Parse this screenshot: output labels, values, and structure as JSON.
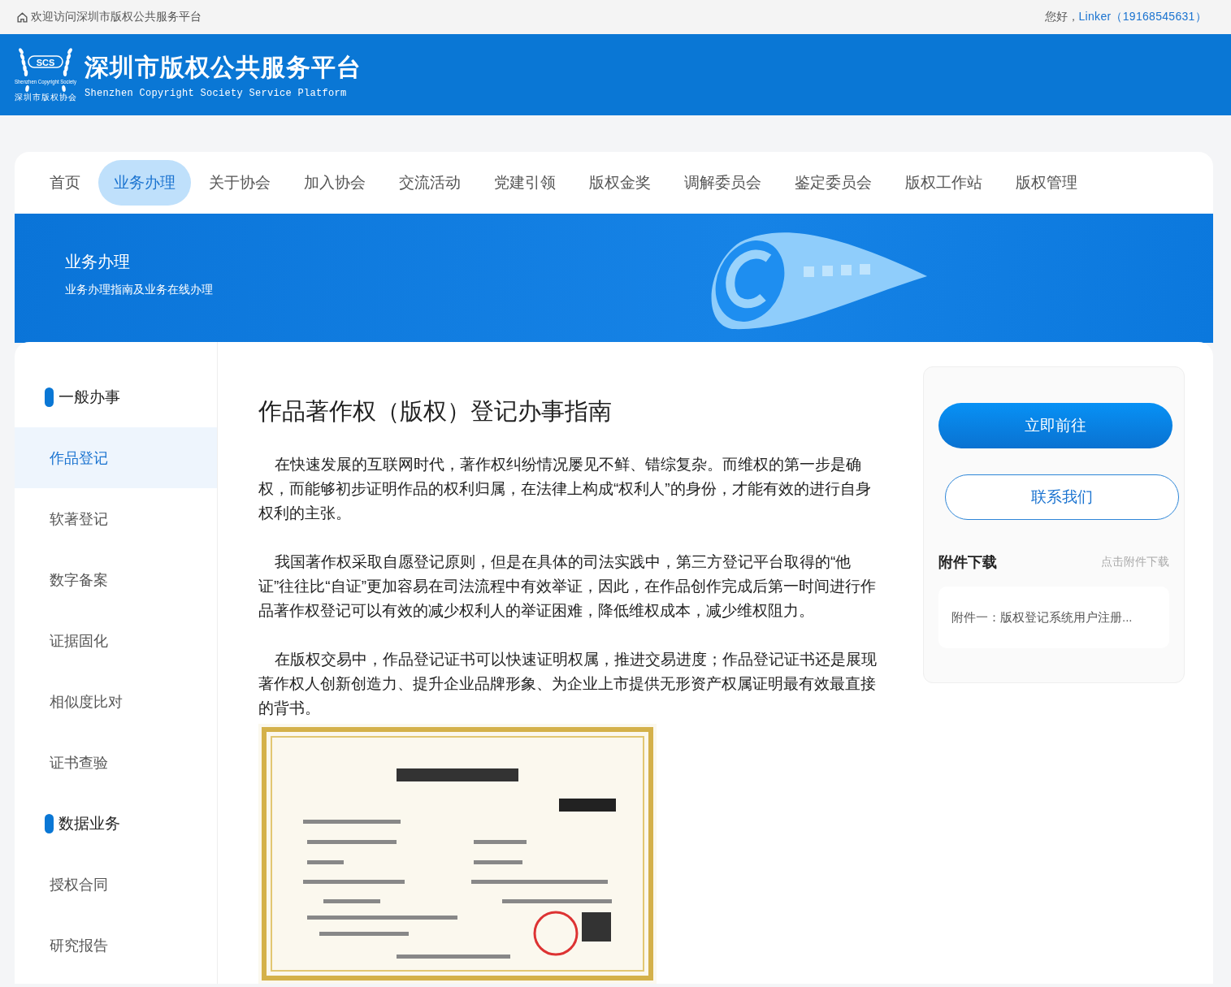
{
  "top_bar": {
    "welcome": "欢迎访问深圳市版权公共服务平台",
    "greeting": "您好，",
    "user": "Linker（19168545631）"
  },
  "header": {
    "logo": {
      "mark": "SCS",
      "small": "Shenzhen Copyright Society",
      "caption": "深圳市版权协会"
    },
    "title": "深圳市版权公共服务平台",
    "subtitle": "Shenzhen Copyright Society Service Platform"
  },
  "nav": [
    {
      "label": "首页",
      "selected": false
    },
    {
      "label": "业务办理",
      "selected": true
    },
    {
      "label": "关于协会",
      "selected": false
    },
    {
      "label": "加入协会",
      "selected": false
    },
    {
      "label": "交流活动",
      "selected": false
    },
    {
      "label": "党建引领",
      "selected": false
    },
    {
      "label": "版权金奖",
      "selected": false
    },
    {
      "label": "调解委员会",
      "selected": false
    },
    {
      "label": "鉴定委员会",
      "selected": false
    },
    {
      "label": "版权工作站",
      "selected": false
    },
    {
      "label": "版权管理",
      "selected": false
    }
  ],
  "banner": {
    "title": "业务办理",
    "subtitle": "业务办理指南及业务在线办理"
  },
  "sidebar": {
    "groups": [
      {
        "label": "一般办事",
        "children": [
          {
            "label": "作品登记",
            "selected": true
          },
          {
            "label": "软著登记",
            "selected": false
          },
          {
            "label": "数字备案",
            "selected": false
          },
          {
            "label": "证据固化",
            "selected": false
          },
          {
            "label": "相似度比对",
            "selected": false
          },
          {
            "label": "证书查验",
            "selected": false
          }
        ]
      },
      {
        "label": "数据业务",
        "children": [
          {
            "label": "授权合同",
            "selected": false
          },
          {
            "label": "研究报告",
            "selected": false
          }
        ]
      }
    ]
  },
  "article": {
    "title": "作品著作权（版权）登记办事指南",
    "paragraphs": [
      "在快速发展的互联网时代，著作权纠纷情况屡见不鲜、错综复杂。而维权的第一步是确权，而能够初步证明作品的权利归属，在法律上构成“权利人”的身份，才能有效的进行自身权利的主张。",
      "我国著作权采取自愿登记原则，但是在具体的司法实践中，第三方登记平台取得的“他证”往往比“自证”更加容易在司法流程中有效举证，因此，在作品创作完成后第一时间进行作品著作权登记可以有效的减少权利人的举证困难，降低维权成本，减少维权阻力。",
      "在版权交易中，作品登记证书可以快速证明权属，推进交易进度；作品登记证书还是展现著作权人创新创造力、提升企业品牌形象、为企业上市提供无形资产权属证明最有效最直接的背书。"
    ]
  },
  "side_panel": {
    "primary_button": "立即前往",
    "secondary_button": "联系我们",
    "attachments": {
      "title": "附件下载",
      "hint": "点击附件下载",
      "items": [
        "附件一：版权登记系统用户注册..."
      ]
    }
  }
}
